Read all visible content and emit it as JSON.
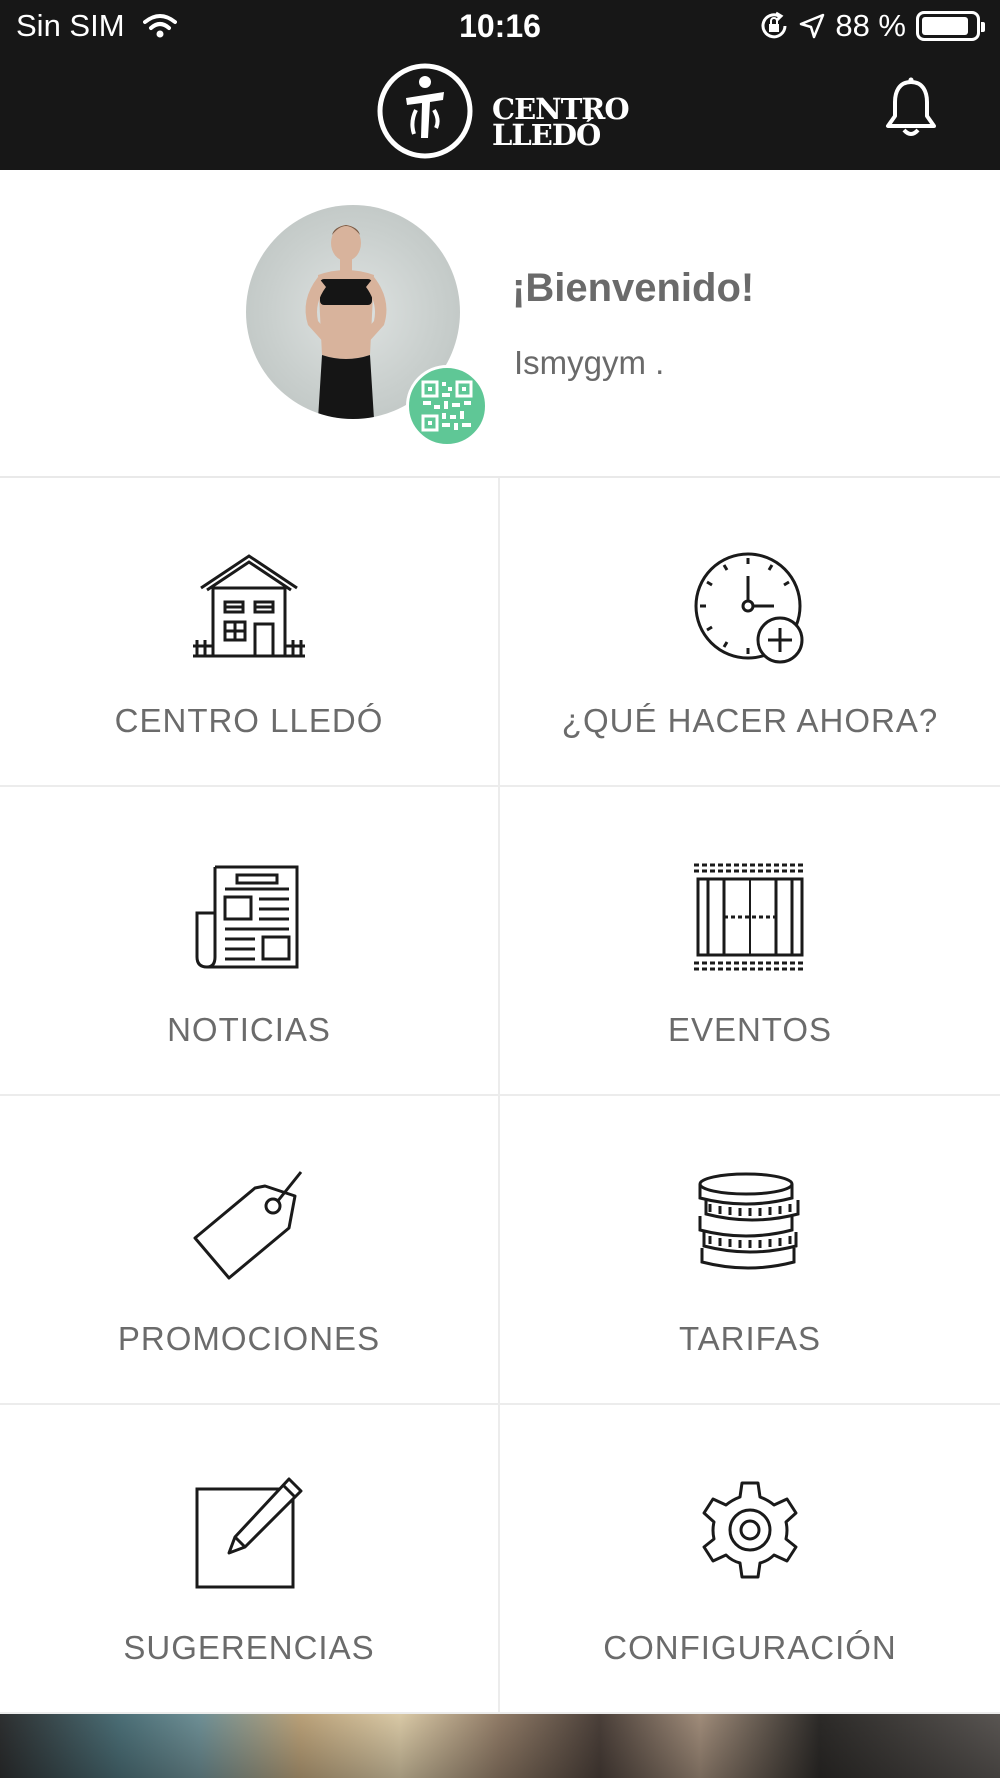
{
  "status_bar": {
    "carrier": "Sin SIM",
    "time": "10:16",
    "battery": "88 %",
    "battery_level": 0.88
  },
  "header": {
    "logo_line1": "CENTRO",
    "logo_line2": "LLEDÓ"
  },
  "profile": {
    "welcome": "¡Bienvenido!",
    "username": "Ismygym ."
  },
  "menu": [
    {
      "label": "CENTRO LLEDÓ",
      "icon": "house-icon"
    },
    {
      "label": "¿QUÉ HACER AHORA?",
      "icon": "clock-plus-icon"
    },
    {
      "label": "NOTICIAS",
      "icon": "newspaper-icon"
    },
    {
      "label": "EVENTOS",
      "icon": "court-icon"
    },
    {
      "label": "PROMOCIONES",
      "icon": "tag-icon"
    },
    {
      "label": "TARIFAS",
      "icon": "coins-icon"
    },
    {
      "label": "SUGERENCIAS",
      "icon": "edit-icon"
    },
    {
      "label": "CONFIGURACIÓN",
      "icon": "gear-icon"
    }
  ],
  "colors": {
    "header_bg": "#171717",
    "qr_badge": "#5fc796",
    "text": "#6b6b6b"
  }
}
